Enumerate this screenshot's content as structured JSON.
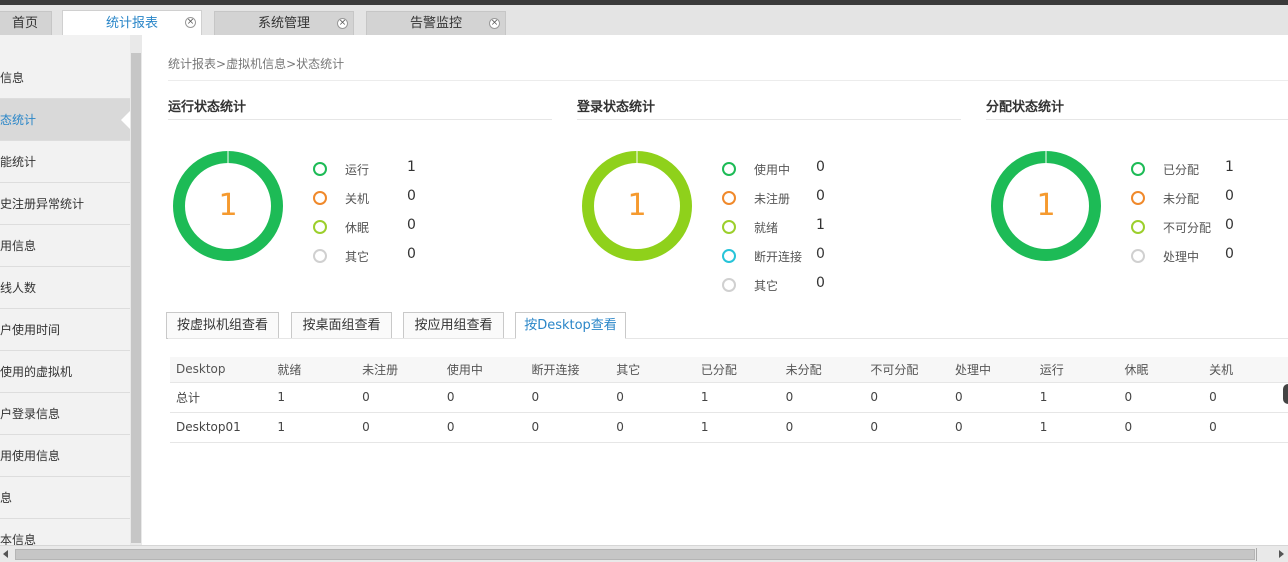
{
  "tabs": [
    {
      "label": "首页",
      "closable": false,
      "active": false
    },
    {
      "label": "统计报表",
      "closable": true,
      "active": true
    },
    {
      "label": "系统管理",
      "closable": true,
      "active": false
    },
    {
      "label": "告警监控",
      "closable": true,
      "active": false
    }
  ],
  "sidebar": {
    "items": [
      {
        "label": "信息"
      },
      {
        "label": "态统计"
      },
      {
        "label": "能统计"
      },
      {
        "label": "史注册异常统计"
      },
      {
        "label": "用信息"
      },
      {
        "label": "线人数"
      },
      {
        "label": "户使用时间"
      },
      {
        "label": "使用的虚拟机"
      },
      {
        "label": "户登录信息"
      },
      {
        "label": "用使用信息"
      },
      {
        "label": "息"
      },
      {
        "label": "本信息"
      }
    ]
  },
  "breadcrumb": {
    "part1": "统计报表",
    "part2": "虚拟机信息",
    "part3": "状态统计",
    "sep": ">"
  },
  "sections": [
    {
      "title": "运行状态统计",
      "total": "1",
      "legend": [
        {
          "label": "运行",
          "value": "1",
          "color": "#1dbb56"
        },
        {
          "label": "关机",
          "value": "0",
          "color": "#f0892b"
        },
        {
          "label": "休眠",
          "value": "0",
          "color": "#9ccf2c"
        },
        {
          "label": "其它",
          "value": "0",
          "color": "#d0d0d0"
        }
      ]
    },
    {
      "title": "登录状态统计",
      "total": "1",
      "legend": [
        {
          "label": "使用中",
          "value": "0",
          "color": "#1dbb56"
        },
        {
          "label": "未注册",
          "value": "0",
          "color": "#f0892b"
        },
        {
          "label": "就绪",
          "value": "1",
          "color": "#9ccf2c"
        },
        {
          "label": "断开连接",
          "value": "0",
          "color": "#27c4d9"
        },
        {
          "label": "其它",
          "value": "0",
          "color": "#d0d0d0"
        }
      ]
    },
    {
      "title": "分配状态统计",
      "total": "1",
      "legend": [
        {
          "label": "已分配",
          "value": "1",
          "color": "#1dbb56"
        },
        {
          "label": "未分配",
          "value": "0",
          "color": "#f0892b"
        },
        {
          "label": "不可分配",
          "value": "0",
          "color": "#9ccf2c"
        },
        {
          "label": "处理中",
          "value": "0",
          "color": "#d0d0d0"
        }
      ]
    }
  ],
  "colors": {
    "donut_green": "#1dbb56",
    "donut_lime": "#8fd11b",
    "center_number": "#f59a2f",
    "accent": "#2a86c8"
  },
  "view_buttons": [
    {
      "label": "按虚拟机组查看"
    },
    {
      "label": "按桌面组查看"
    },
    {
      "label": "按应用组查看"
    },
    {
      "label": "按Desktop查看"
    }
  ],
  "table": {
    "headers": [
      "Desktop",
      "就绪",
      "未注册",
      "使用中",
      "断开连接",
      "其它",
      "已分配",
      "未分配",
      "不可分配",
      "处理中",
      "运行",
      "休眠",
      "关机"
    ],
    "rows": [
      [
        "总计",
        "1",
        "0",
        "0",
        "0",
        "0",
        "1",
        "0",
        "0",
        "0",
        "1",
        "0",
        "0"
      ],
      [
        "Desktop01",
        "1",
        "0",
        "0",
        "0",
        "0",
        "1",
        "0",
        "0",
        "0",
        "1",
        "0",
        "0"
      ]
    ]
  }
}
